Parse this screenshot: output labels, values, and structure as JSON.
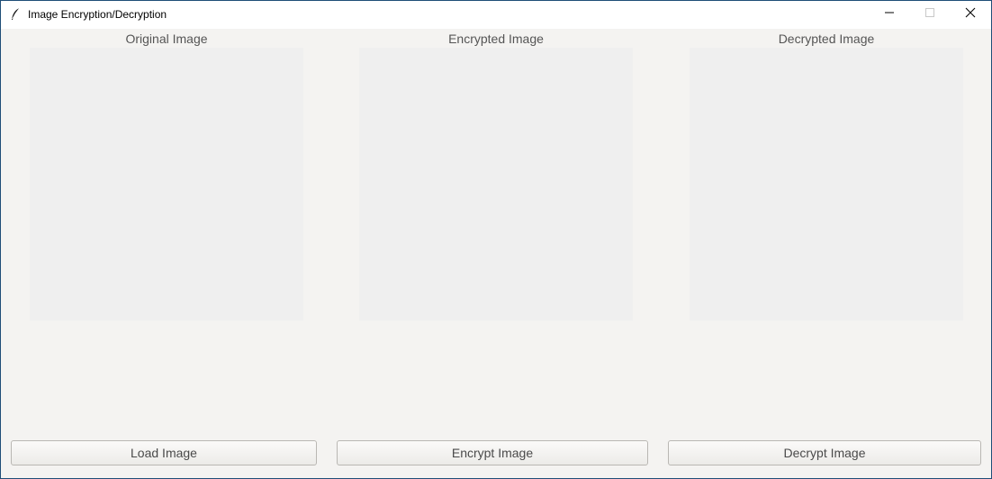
{
  "window": {
    "title": "Image Encryption/Decryption",
    "app_icon": "feather-icon",
    "controls": {
      "minimize_icon": "minimize-icon",
      "maximize_icon": "maximize-icon",
      "close_icon": "close-icon"
    }
  },
  "panels": {
    "original": {
      "label": "Original Image"
    },
    "encrypted": {
      "label": "Encrypted Image"
    },
    "decrypted": {
      "label": "Decrypted Image"
    }
  },
  "buttons": {
    "load": "Load Image",
    "encrypt": "Encrypt Image",
    "decrypt": "Decrypt Image"
  },
  "colors": {
    "window_background": "#f4f3f1",
    "image_placeholder": "#efefef",
    "border_accent": "#1f4e78"
  }
}
